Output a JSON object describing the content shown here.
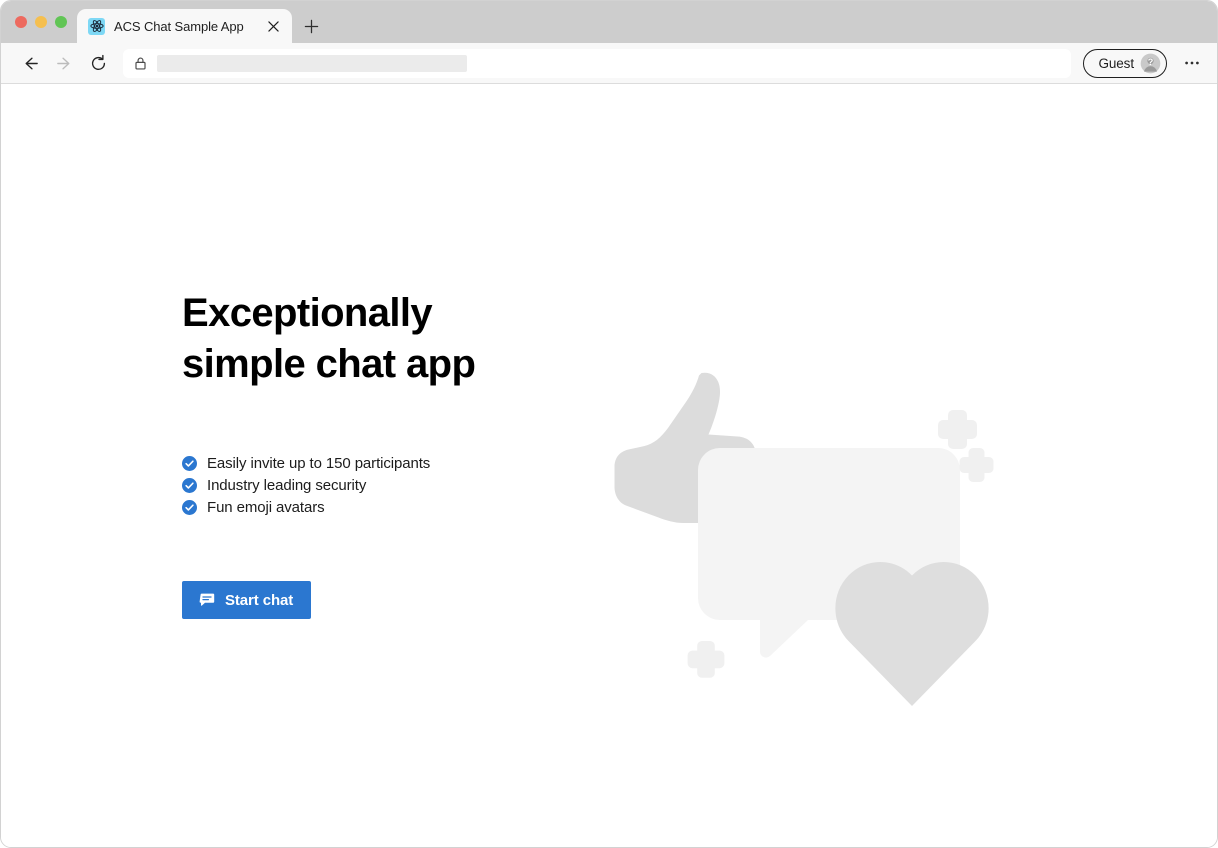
{
  "window": {
    "traffic_lights": [
      {
        "name": "close",
        "color": "#ed6a5f"
      },
      {
        "name": "minimize",
        "color": "#f5bf4f"
      },
      {
        "name": "maximize",
        "color": "#61c555"
      }
    ]
  },
  "browser": {
    "tab": {
      "title": "ACS Chat Sample App",
      "favicon": "react-logo-icon",
      "close_label": "×"
    },
    "new_tab_label": "+",
    "toolbar": {
      "back_icon": "arrow-left-icon",
      "forward_icon": "arrow-right-icon",
      "reload_icon": "reload-icon",
      "lock_icon": "lock-icon",
      "url_value": "",
      "url_placeholder": "",
      "profile_label": "Guest",
      "profile_avatar_icon": "guest-avatar-icon",
      "more_icon": "ellipsis-icon"
    }
  },
  "page": {
    "headline": "Exceptionally simple chat app",
    "features": [
      {
        "icon": "check-circle-icon",
        "text": "Easily invite up to 150 participants"
      },
      {
        "icon": "check-circle-icon",
        "text": "Industry leading security"
      },
      {
        "icon": "check-circle-icon",
        "text": "Fun emoji avatars"
      }
    ],
    "start_button": {
      "label": "Start chat",
      "icon": "chat-bubble-icon"
    },
    "illustration": {
      "shapes": [
        "thumbs-up",
        "speech-bubble",
        "heart",
        "sparkle-plus"
      ],
      "colors": {
        "thumb": "#dcdcdc",
        "bubble": "#f4f4f4",
        "heart": "#dedede",
        "sparkle": "#f0f0f0"
      }
    },
    "colors": {
      "accent": "#2b77d0",
      "text": "#1c1c1c",
      "background": "#ffffff"
    }
  }
}
